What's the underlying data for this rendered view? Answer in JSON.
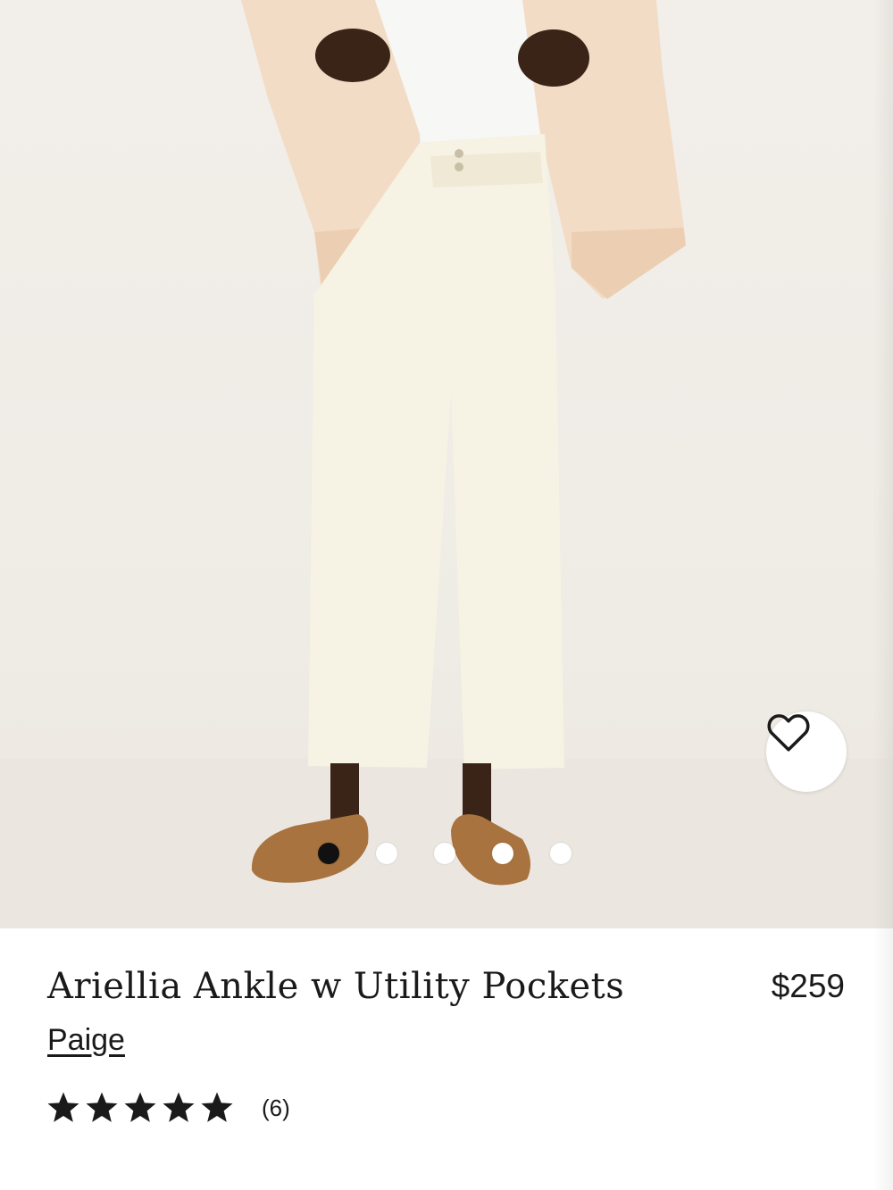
{
  "product": {
    "title": "Ariellia Ankle w Utility Pockets",
    "brand": "Paige",
    "price": "$259",
    "rating": {
      "value": 5,
      "max": 5,
      "count_text": "(6)"
    }
  },
  "gallery": {
    "image_count": 5,
    "active_index": 0
  },
  "icons": {
    "wishlist": "heart-outline-icon",
    "rating": "star-icon"
  },
  "colors": {
    "text": "#1a1a1a",
    "dot_active": "#111111",
    "dot_inactive": "#ffffff",
    "image_background": "#f2efea"
  }
}
